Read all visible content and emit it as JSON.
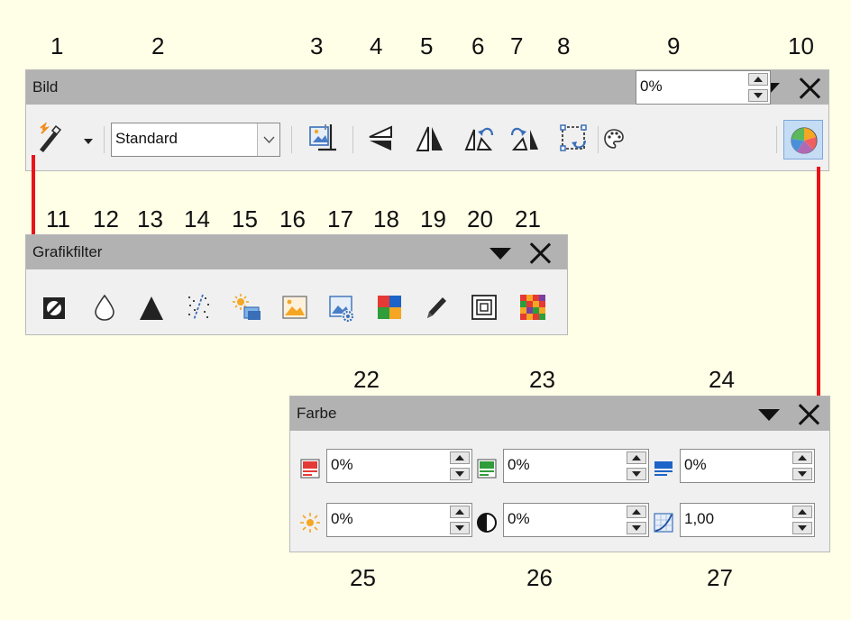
{
  "callouts": {
    "top": [
      "1",
      "2",
      "3",
      "4",
      "5",
      "6",
      "7",
      "8",
      "9",
      "10"
    ],
    "filter": [
      "11",
      "12",
      "13",
      "14",
      "15",
      "16",
      "17",
      "18",
      "19",
      "20",
      "21"
    ],
    "farbe_top": [
      "22",
      "23",
      "24"
    ],
    "farbe_bottom": [
      "25",
      "26",
      "27"
    ]
  },
  "bild_toolbar": {
    "title": "Bild",
    "filter_dropdown_icon": "graphic-filter-wand-icon",
    "graphic_mode": {
      "value": "Standard"
    },
    "crop_icon": "crop-icon",
    "flip_vertical_icon": "flip-vertical-icon",
    "flip_horizontal_icon": "flip-horizontal-icon",
    "rotate_left_icon": "rotate-left-icon",
    "rotate_right_icon": "rotate-right-icon",
    "rotate_mode_icon": "rotate-icon",
    "transparency_icon": "transparency-icon",
    "transparency": {
      "value": "0%"
    },
    "color_icon": "color-wheel-icon"
  },
  "filter_toolbar": {
    "title": "Grafikfilter",
    "filters": [
      {
        "name": "invert",
        "icon": "invert-icon"
      },
      {
        "name": "smooth",
        "icon": "smooth-drop-icon"
      },
      {
        "name": "sharpen",
        "icon": "sharpen-icon"
      },
      {
        "name": "remove-noise",
        "icon": "remove-noise-icon"
      },
      {
        "name": "solarization",
        "icon": "solarization-icon"
      },
      {
        "name": "aging",
        "icon": "aging-icon"
      },
      {
        "name": "posterize",
        "icon": "posterize-icon"
      },
      {
        "name": "pop-art",
        "icon": "pop-art-icon"
      },
      {
        "name": "charcoal-sketch",
        "icon": "charcoal-pencil-icon"
      },
      {
        "name": "relief",
        "icon": "relief-icon"
      },
      {
        "name": "mosaic",
        "icon": "mosaic-icon"
      }
    ]
  },
  "farbe_toolbar": {
    "title": "Farbe",
    "red": {
      "icon": "red-channel-icon",
      "value": "0%"
    },
    "green": {
      "icon": "green-channel-icon",
      "value": "0%"
    },
    "blue": {
      "icon": "blue-channel-icon",
      "value": "0%"
    },
    "brightness": {
      "icon": "brightness-sun-icon",
      "value": "0%"
    },
    "contrast": {
      "icon": "contrast-icon",
      "value": "0%"
    },
    "gamma": {
      "icon": "gamma-curve-icon",
      "value": "1,00"
    }
  },
  "colors": {
    "background": "#fffee6",
    "titlebar": "#b2b2b2",
    "toolbar": "#f0f0f0",
    "callout_line": "#e8141a",
    "active_button": "#c5dcf5"
  }
}
